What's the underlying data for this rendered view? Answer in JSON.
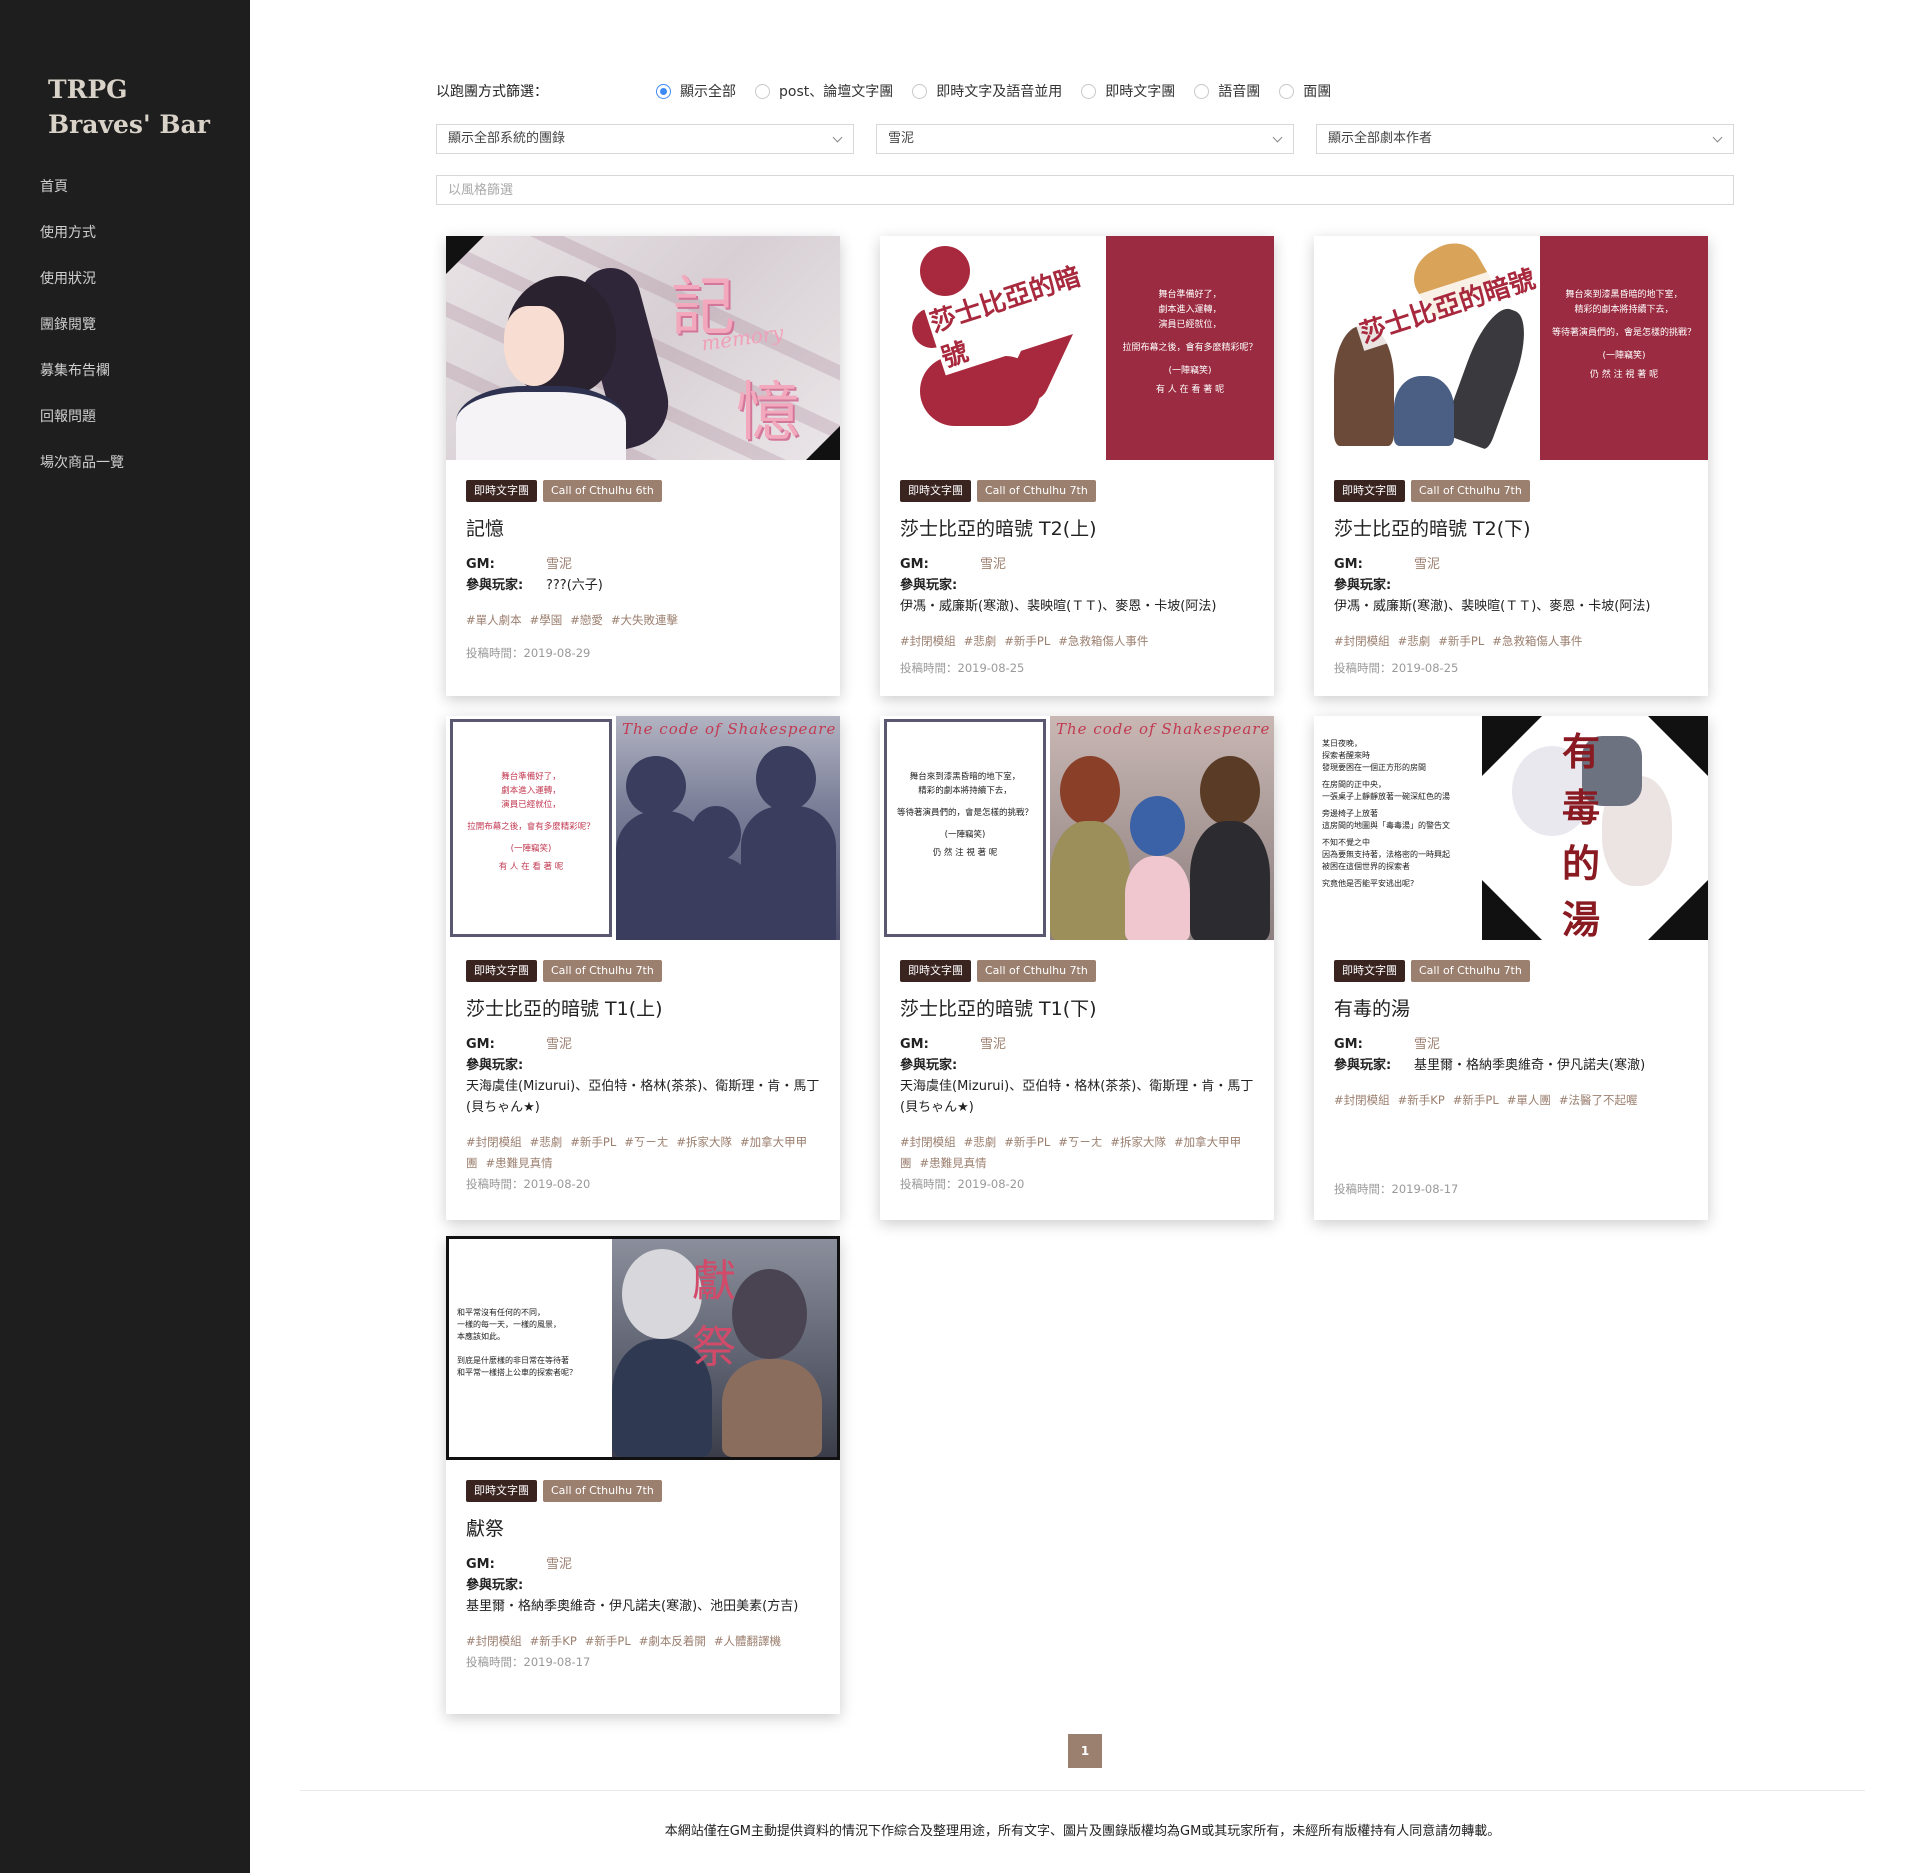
{
  "brand": "TRPG Braves' Bar",
  "nav": [
    "首頁",
    "使用方式",
    "使用狀況",
    "團錄閱覽",
    "募集布告欄",
    "回報問題",
    "場次商品一覽"
  ],
  "filter": {
    "label": "以跑團方式篩選：",
    "options": [
      "顯示全部",
      "post、論壇文字團",
      "即時文字及語音並用",
      "即時文字團",
      "語音團",
      "面團"
    ],
    "selected": "顯示全部",
    "system_select": "顯示全部系統的團錄",
    "gm_select": "雪泥",
    "author_select": "顯示全部劇本作者",
    "style_placeholder": "以風格篩選"
  },
  "labels": {
    "gm": "GM:",
    "players": "參與玩家:",
    "posted_prefix": "投稿時間："
  },
  "cards": [
    {
      "type_tag": "即時文字團",
      "system_tag": "Call of Cthulhu 6th",
      "title": "記憶",
      "gm": "雪泥",
      "players": "???(六子)",
      "hashtags": [
        "#單人劇本",
        "#學園",
        "#戀愛",
        "#大失敗連擊"
      ],
      "posted": "投稿時間：2019-08-29",
      "cover": {
        "kanji_top": "記",
        "kanji_bottom": "憶",
        "script": "memory"
      }
    },
    {
      "type_tag": "即時文字團",
      "system_tag": "Call of Cthulhu 7th",
      "title": "莎士比亞的暗號 T2(上)",
      "gm": "雪泥",
      "players": "伊馮・威廉斯(寒澈)、裴映暄(ＴＴ)、麥恩・卡坡(阿法)",
      "hashtags": [
        "#封閉模組",
        "#悲劇",
        "#新手PL",
        "#急救箱傷人事件"
      ],
      "posted": "投稿時間：2019-08-25",
      "cover": {
        "title_art": "莎士比亞的暗號",
        "lines": [
          "舞台準備好了，",
          "劇本進入運轉，",
          "演員已經就位，",
          "",
          "拉開布幕之後，會有多麼精彩呢？",
          "",
          "(一陣竊笑)",
          "",
          "有 人 在 看 著 呢"
        ]
      }
    },
    {
      "type_tag": "即時文字團",
      "system_tag": "Call of Cthulhu 7th",
      "title": "莎士比亞的暗號 T2(下)",
      "gm": "雪泥",
      "players": "伊馮・威廉斯(寒澈)、裴映暄(ＴＴ)、麥恩・卡坡(阿法)",
      "hashtags": [
        "#封閉模組",
        "#悲劇",
        "#新手PL",
        "#急救箱傷人事件"
      ],
      "posted": "投稿時間：2019-08-25",
      "cover": {
        "title_art": "莎士比亞的暗號",
        "lines": [
          "舞台來到漆黑昏暗的地下室，",
          "精彩的劇本將持續下去，",
          "",
          "等待著演員們的，會是怎樣的挑戰？",
          "",
          "(一陣竊笑)",
          "",
          "仍 然 注 視 著 呢"
        ]
      }
    },
    {
      "type_tag": "即時文字團",
      "system_tag": "Call of Cthulhu 7th",
      "title": "莎士比亞的暗號 T1(上)",
      "gm": "雪泥",
      "players": "天海虞佳(Mizurui)、亞伯特・格林(茶茶)、衛斯理・肯・馬丁(貝ちゃん★)",
      "hashtags": [
        "#封閉模組",
        "#悲劇",
        "#新手PL",
        "#ㄎㄧㄤ",
        "#拆家大隊",
        "#加拿大甲甲團",
        "#患難見真情"
      ],
      "posted": "投稿時間：2019-08-20",
      "cover": {
        "script": "The code of Shakespeare",
        "lines": [
          "舞台準備好了，",
          "劇本進入運轉，",
          "演員已經就位，",
          "",
          "拉開布幕之後，會有多麼精彩呢？",
          "",
          "(一陣竊笑)",
          "",
          "有 人 在 看 著 呢"
        ]
      }
    },
    {
      "type_tag": "即時文字團",
      "system_tag": "Call of Cthulhu 7th",
      "title": "莎士比亞的暗號 T1(下)",
      "gm": "雪泥",
      "players": "天海虞佳(Mizurui)、亞伯特・格林(茶茶)、衛斯理・肯・馬丁(貝ちゃん★)",
      "hashtags": [
        "#封閉模組",
        "#悲劇",
        "#新手PL",
        "#ㄎㄧㄤ",
        "#拆家大隊",
        "#加拿大甲甲團",
        "#患難見真情"
      ],
      "posted": "投稿時間：2019-08-20",
      "cover": {
        "script": "The code of Shakespeare",
        "lines": [
          "舞台來到漆黑昏暗的地下室，",
          "精彩的劇本將持續下去，",
          "",
          "等待著演員們的，會是怎樣的挑戰？",
          "",
          "(一陣竊笑)",
          "",
          "仍 然 注 視 著 呢"
        ]
      }
    },
    {
      "type_tag": "即時文字團",
      "system_tag": "Call of Cthulhu 7th",
      "title": "有毒的湯",
      "gm": "雪泥",
      "players": "基里爾・格納季奧維奇・伊凡諾夫(寒澈)",
      "hashtags": [
        "#封閉模組",
        "#新手KP",
        "#新手PL",
        "#單人團",
        "#法醫了不起喔"
      ],
      "posted": "投稿時間：2019-08-17",
      "cover": {
        "title_art": "有毒的湯",
        "lines": [
          "某日夜晚，",
          "探索者醒來時",
          "發現要困在一個正方形的房間",
          "",
          "在房間的正中央，",
          "一張桌子上靜靜放著一碗深紅色的湯",
          "",
          "旁邊椅子上放著",
          "這房間的地圖與「毒毒湯」的警告文",
          "",
          "不知不覺之中",
          "因為要無支持著，法格密的一時興起",
          "被困在這個世界的探索者",
          "",
          "究竟他是否能平安逃出呢?"
        ]
      }
    },
    {
      "type_tag": "即時文字團",
      "system_tag": "Call of Cthulhu 7th",
      "title": "獻祭",
      "gm": "雪泥",
      "players": "基里爾・格納季奧維奇・伊凡諾夫(寒澈)、池田美素(方吉)",
      "hashtags": [
        "#封閉模組",
        "#新手KP",
        "#新手PL",
        "#劇本反着開",
        "#人體翻譯機"
      ],
      "posted": "投稿時間：2019-08-17",
      "cover": {
        "title_art": "獻祭",
        "lines": [
          "和平常沒有任何的不同，",
          "一樣的每一天，一樣的風景，",
          "本應該如此。",
          "",
          "到底是什麼樣的非日常在等待著",
          "和平常一樣搭上公車的探索者呢？"
        ]
      }
    }
  ],
  "pagination": {
    "current": "1"
  },
  "footer": "本網站僅在GM主動提供資料的情況下作綜合及整理用途，所有文字、圖片及團錄版權均為GM或其玩家所有，未經所有版權持有人同意請勿轉載。"
}
